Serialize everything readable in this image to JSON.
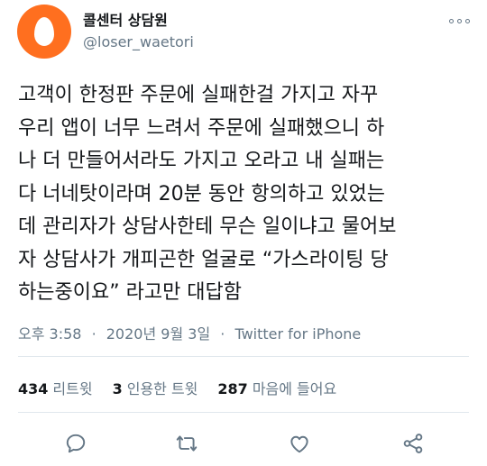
{
  "user": {
    "display_name": "콜센터 상담원",
    "handle": "@loser_waetori",
    "avatar_color": "#ff6f1f"
  },
  "tweet": {
    "lines": [
      "고객이 한정판 주문에 실패한걸 가지고 자꾸",
      "우리 앱이 너무 느려서 주문에 실패했으니 하",
      "나 더 만들어서라도 가지고 오라고 내 실패는",
      "다 너네탓이라며 20분 동안 항의하고 있었는",
      "데 관리자가 상담사한테 무슨 일이냐고 물어보",
      "자 상담사가 개피곤한 얼굴로 “가스라이팅 당",
      "하는중이요” 라고만 대답함"
    ]
  },
  "meta": {
    "time": "오후 3:58",
    "date": "2020년 9월 3일",
    "separator": "·",
    "source": "Twitter for iPhone"
  },
  "stats": {
    "retweets_count": "434",
    "retweets_label": "리트윗",
    "quotes_count": "3",
    "quotes_label": "인용한 트윗",
    "likes_count": "287",
    "likes_label": "마음에 들어요"
  },
  "actions": {
    "icons": [
      "reply-icon",
      "retweet-icon",
      "like-icon",
      "share-icon"
    ],
    "icon_color": "#657786"
  }
}
